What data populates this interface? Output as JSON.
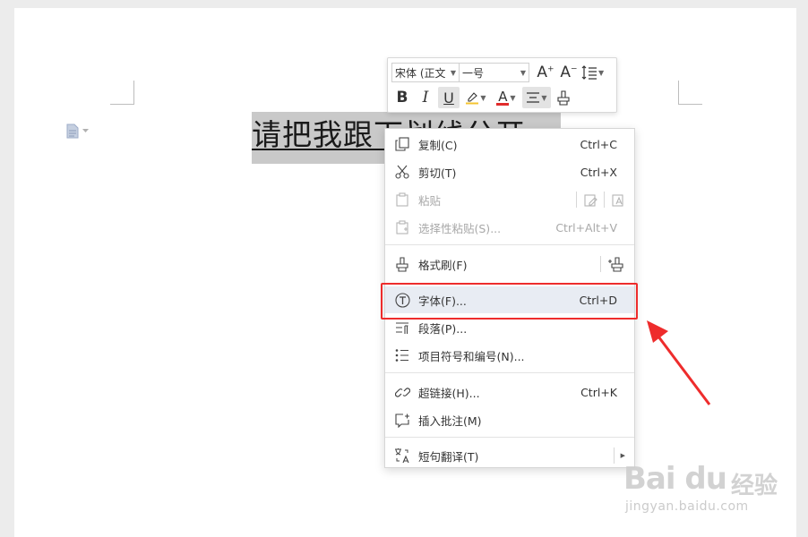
{
  "document": {
    "text_before": "请把我跟",
    "text_after": "下划线分开"
  },
  "mini_toolbar": {
    "font_name": "宋体 (正文",
    "font_size": "一号",
    "grow_font_label": "A",
    "shrink_font_label": "A",
    "bold_label": "B",
    "italic_label": "I",
    "underline_label": "U",
    "font_color_label": "A"
  },
  "context_menu": {
    "items": [
      {
        "label": "复制(C)",
        "shortcut": "Ctrl+C",
        "icon": "copy-icon"
      },
      {
        "label": "剪切(T)",
        "shortcut": "Ctrl+X",
        "icon": "scissors-icon"
      },
      {
        "label": "粘贴",
        "shortcut": "",
        "icon": "paste-icon",
        "disabled": true
      },
      {
        "label": "选择性粘贴(S)...",
        "shortcut": "Ctrl+Alt+V",
        "icon": "paste-special-icon",
        "disabled": true
      },
      {
        "label": "格式刷(F)",
        "shortcut": "",
        "icon": "format-painter-icon"
      },
      {
        "label": "字体(F)...",
        "shortcut": "Ctrl+D",
        "icon": "font-icon"
      },
      {
        "label": "段落(P)...",
        "shortcut": "",
        "icon": "paragraph-icon"
      },
      {
        "label": "项目符号和编号(N)...",
        "shortcut": "",
        "icon": "bullets-icon"
      },
      {
        "label": "超链接(H)...",
        "shortcut": "Ctrl+K",
        "icon": "link-icon"
      },
      {
        "label": "插入批注(M)",
        "shortcut": "",
        "icon": "comment-icon"
      },
      {
        "label": "短句翻译(T)",
        "shortcut": "",
        "icon": "translate-icon"
      }
    ]
  },
  "watermark": {
    "logo": "Bai du",
    "brand": "经验",
    "url": "jingyan.baidu.com"
  },
  "colors": {
    "highlight_box": "#ee2c2c",
    "selection": "#c9c9c9",
    "menu_highlight": "#e8ecf3"
  }
}
